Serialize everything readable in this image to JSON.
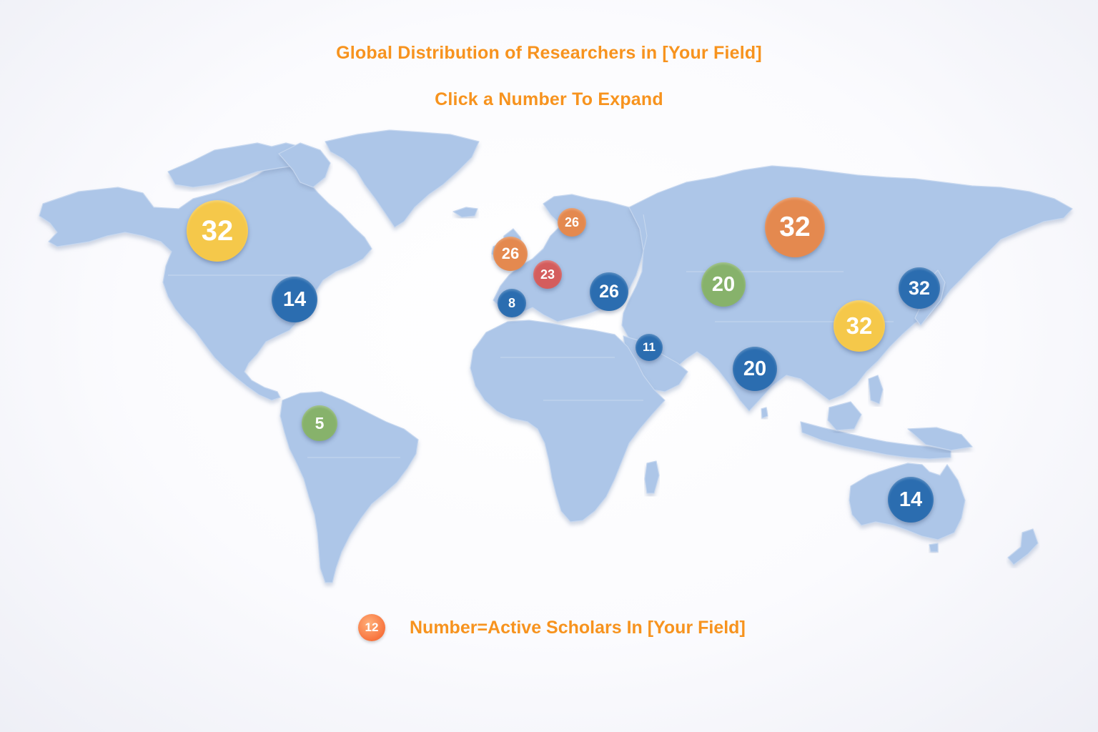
{
  "header": {
    "title": "Global Distribution of Researchers in [Your Field]",
    "subtitle": "Click a Number To Expand"
  },
  "colors": {
    "title_text": "#f7931e",
    "land": "#adc6e8",
    "blue": "#2b6db0",
    "orange": "#e4894f",
    "yellow": "#f5c84a",
    "green": "#87b26b",
    "red": "#d45d5d"
  },
  "markers": [
    {
      "id": "canada",
      "value": "32",
      "color": "yellow"
    },
    {
      "id": "usa-east",
      "value": "14",
      "color": "blue"
    },
    {
      "id": "colombia",
      "value": "5",
      "color": "green"
    },
    {
      "id": "scandinavia",
      "value": "26",
      "color": "orange"
    },
    {
      "id": "uk",
      "value": "26",
      "color": "orange"
    },
    {
      "id": "central-europe",
      "value": "23",
      "color": "red"
    },
    {
      "id": "spain",
      "value": "8",
      "color": "blue"
    },
    {
      "id": "turkey",
      "value": "26",
      "color": "blue"
    },
    {
      "id": "middle-east",
      "value": "11",
      "color": "blue"
    },
    {
      "id": "central-asia",
      "value": "20",
      "color": "green"
    },
    {
      "id": "russia",
      "value": "32",
      "color": "orange"
    },
    {
      "id": "india",
      "value": "20",
      "color": "blue"
    },
    {
      "id": "china-east",
      "value": "32",
      "color": "yellow"
    },
    {
      "id": "japan-korea",
      "value": "32",
      "color": "blue"
    },
    {
      "id": "australia",
      "value": "14",
      "color": "blue"
    }
  ],
  "legend": {
    "sample_value": "12",
    "text": "Number=Active Scholars In [Your Field]"
  }
}
